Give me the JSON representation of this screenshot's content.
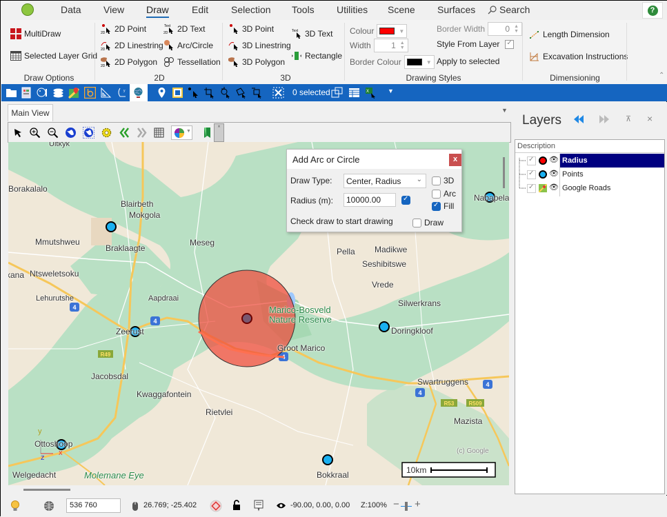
{
  "app": {
    "logo_icon": "africa-logo-icon"
  },
  "menu": {
    "items": [
      "Data",
      "View",
      "Draw",
      "Edit",
      "Selection",
      "Tools",
      "Utilities",
      "Scene",
      "Surfaces"
    ],
    "active": "Draw",
    "search_label": "Search",
    "help_label": "?"
  },
  "ribbon": {
    "draw_options": {
      "group_label": "Draw Options",
      "multidraw": "MultiDraw",
      "selected_layer_grid": "Selected Layer Grid"
    },
    "group_2d": {
      "group_label": "2D",
      "point": "2D Point",
      "linestring": "2D Linestring",
      "polygon": "2D Polygon",
      "text": "2D Text",
      "arc_circle": "Arc/Circle",
      "tessellation": "Tessellation"
    },
    "group_3d": {
      "group_label": "3D",
      "point": "3D Point",
      "linestring": "3D Linestring",
      "polygon": "3D Polygon",
      "text": "3D Text",
      "rectangle": "Rectangle"
    },
    "drawing_styles": {
      "group_label": "Drawing Styles",
      "colour_label": "Colour",
      "colour_value": "#ff0000",
      "width_label": "Width",
      "width_value": "1",
      "border_colour_label": "Border Colour",
      "border_colour_value": "#000000",
      "border_width_label": "Border Width",
      "border_width_value": "0",
      "style_from_layer_label": "Style From Layer",
      "style_from_layer_checked": true,
      "apply_to_selected": "Apply to selected"
    },
    "dimensioning": {
      "group_label": "Dimensioning",
      "length_dimension": "Length Dimension",
      "excavation_instructions": "Excavation Instructions"
    }
  },
  "toolbar": {
    "selected_count": "0 selected"
  },
  "document": {
    "tab_label": "Main View",
    "tab_close_hint": "*"
  },
  "map": {
    "attribution": "(c) Google",
    "scale_label": "10km",
    "axes": {
      "x": "x",
      "y": "y",
      "z": "z"
    },
    "place_labels": [
      {
        "name": "Uitkyk"
      },
      {
        "name": "Borakalalo"
      },
      {
        "name": "Blairbeth"
      },
      {
        "name": "Mokgola"
      },
      {
        "name": "Mmutshweu"
      },
      {
        "name": "Braklaagte"
      },
      {
        "name": "Meseg"
      },
      {
        "name": "Ntsweletsoku"
      },
      {
        "name": "kana"
      },
      {
        "name": "Lehurutshe"
      },
      {
        "name": "Aapdraai"
      },
      {
        "name": "Zeerust"
      },
      {
        "name": "Jacobsdal"
      },
      {
        "name": "Kwaggafontein"
      },
      {
        "name": "Rietvlei"
      },
      {
        "name": "Ottoshoop"
      },
      {
        "name": "Welgedacht"
      },
      {
        "name": "Molemane Eye"
      },
      {
        "name": "Marico-Bosveld"
      },
      {
        "name": "Nature Reserve"
      },
      {
        "name": "Groot Marico"
      },
      {
        "name": "Pella"
      },
      {
        "name": "Madikwe"
      },
      {
        "name": "Seshibitswe"
      },
      {
        "name": "Vrede"
      },
      {
        "name": "Silwerkrans"
      },
      {
        "name": "Doringkloof"
      },
      {
        "name": "Swartruggens"
      },
      {
        "name": "Mazista"
      },
      {
        "name": "Bokkraal"
      },
      {
        "name": "Nabapela"
      }
    ],
    "road_shields": [
      "4",
      "4",
      "4",
      "4",
      "4",
      "R49",
      "R53",
      "R509"
    ],
    "colors": {
      "point_fill": "#1ab0f0",
      "circle_fill": "#f05a4a",
      "land": "#f0e8d8",
      "green": "#b9e0c4"
    }
  },
  "dialog": {
    "title": "Add Arc or Circle",
    "close_label": "x",
    "draw_type_label": "Draw Type:",
    "draw_type_value": "Center, Radius",
    "radius_label": "Radius (m):",
    "radius_value": "10000.00",
    "radius_checked": true,
    "check_3d_label": "3D",
    "check_3d": false,
    "check_arc_label": "Arc",
    "check_arc": false,
    "check_fill_label": "Fill",
    "check_fill": true,
    "hint": "Check draw to start drawing",
    "check_draw_label": "Draw",
    "check_draw": false
  },
  "layers": {
    "title": "Layers",
    "column_header": "Description",
    "items": [
      {
        "name": "Radius",
        "visible": true,
        "selected": true,
        "symbol": "red-point"
      },
      {
        "name": "Points",
        "visible": true,
        "selected": false,
        "symbol": "blue-point"
      },
      {
        "name": "Google Roads",
        "visible": true,
        "selected": false,
        "symbol": "google-maps"
      }
    ]
  },
  "status": {
    "scale_value": "536 760",
    "coordinates": "26.769; -25.402",
    "view_angles": "-90.00, 0.00, 0.00",
    "zoom": "Z:100%"
  }
}
